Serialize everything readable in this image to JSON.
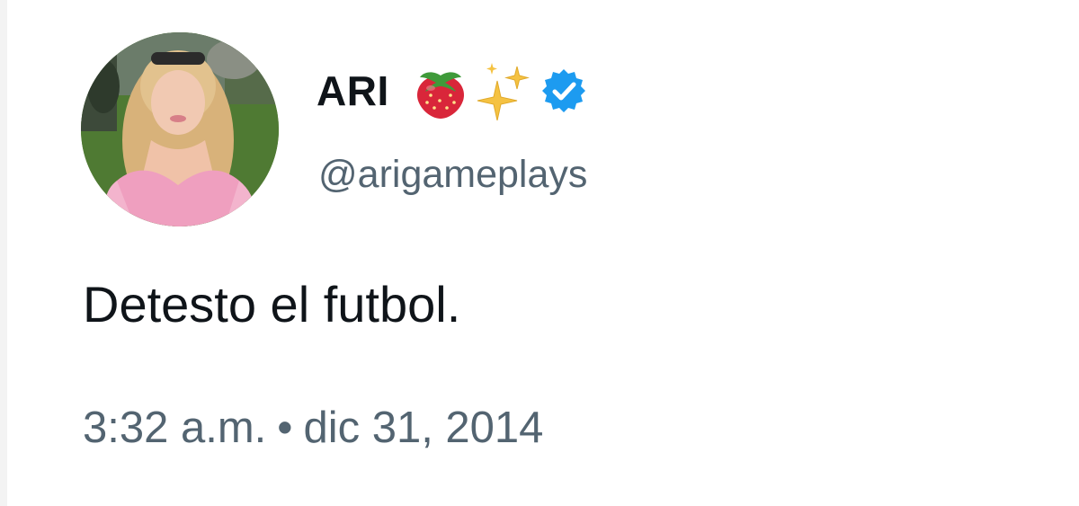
{
  "tweet": {
    "author": {
      "display_name": "ARI",
      "emojis": [
        "strawberry-icon",
        "sparkles-icon"
      ],
      "verified": true,
      "handle": "@arigameplays"
    },
    "text": "Detesto el futbol.",
    "time": "3:32 a.m.",
    "separator": "•",
    "date": "dic 31, 2014"
  },
  "colors": {
    "text_primary": "#0f1419",
    "text_secondary": "#536471",
    "verified_blue": "#1d9bf0",
    "background": "#ffffff"
  }
}
